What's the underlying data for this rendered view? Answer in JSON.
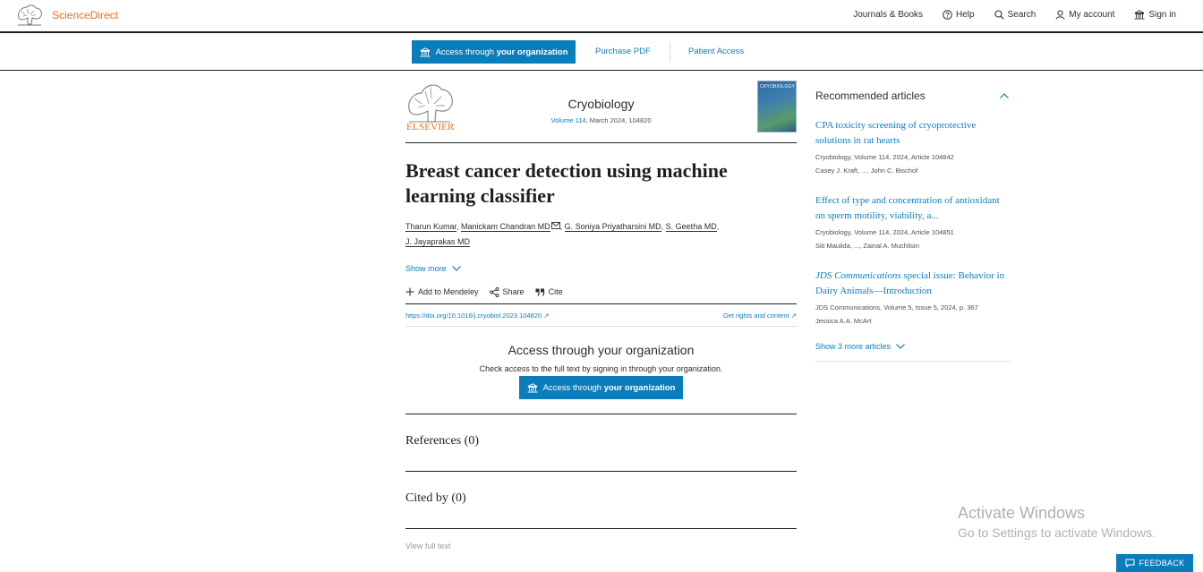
{
  "header": {
    "brand": "ScienceDirect",
    "nav": [
      {
        "label": "Journals & Books",
        "icon": ""
      },
      {
        "label": "Help",
        "icon": "help-icon"
      },
      {
        "label": "Search",
        "icon": "search-icon"
      },
      {
        "label": "My account",
        "icon": "user-icon"
      },
      {
        "label": "Sign in",
        "icon": "institution-icon"
      }
    ]
  },
  "access_bar": {
    "button_prefix": "Access through ",
    "button_bold": "your organization",
    "purchase": "Purchase PDF",
    "patient": "Patient Access"
  },
  "journal": {
    "publisher": "ELSEVIER",
    "name": "Cryobiology",
    "volume_link": "Volume 114",
    "meta_rest": ", March 2024, 104820",
    "cover_title": "CRYOBIOLOGY"
  },
  "article": {
    "title": "Breast cancer detection using machine learning classifier",
    "authors": [
      "Tharun Kumar",
      "Manickam Chandran MD",
      "G. Soniya Priyatharsini MD",
      "S. Geetha MD",
      "J. Jayaprakas MD"
    ],
    "show_more": "Show more",
    "actions": {
      "mendeley": "Add to Mendeley",
      "share": "Share",
      "cite": "Cite"
    },
    "doi": "https://doi.org/10.1016/j.cryobiol.2023.104820",
    "rights": "Get rights and content"
  },
  "access_box": {
    "heading": "Access through your organization",
    "text": "Check access to the full text by signing in through your organization.",
    "button_prefix": "Access through ",
    "button_bold": "your organization"
  },
  "sections": {
    "references": "References (0)",
    "cited_by": "Cited by (0)",
    "view_full": "View full text"
  },
  "sidebar": {
    "heading": "Recommended articles",
    "articles": [
      {
        "title": "CPA toxicity screening of cryoprotective solutions in rat hearts",
        "title_italic": "",
        "meta": "Cryobiology, Volume 114, 2024, Article 104842",
        "authors": "Casey J. Kraft, ..., John C. Bischof"
      },
      {
        "title": "Effect of type and concentration of antioxidant on sperm motility, viability, a...",
        "title_italic": "",
        "meta": "Cryobiology, Volume 114, 2024, Article 104851",
        "authors": "Siti Maulida, ..., Zainal A. Muchlisin"
      },
      {
        "title": " special issue: Behavior in Dairy Animals—Introduction",
        "title_italic": "JDS Communications",
        "meta": "JDS Communications, Volume 5, Issue 5, 2024, p. 367",
        "authors": "Jessica A.A. McArt"
      }
    ],
    "show_more": "Show 3 more articles"
  },
  "watermark": {
    "line1": "Activate Windows",
    "line2": "Go to Settings to activate Windows."
  },
  "feedback": "FEEDBACK",
  "colors": {
    "accent": "#0c7dbb",
    "brand": "#e9711c",
    "text": "#2e2e2e"
  }
}
